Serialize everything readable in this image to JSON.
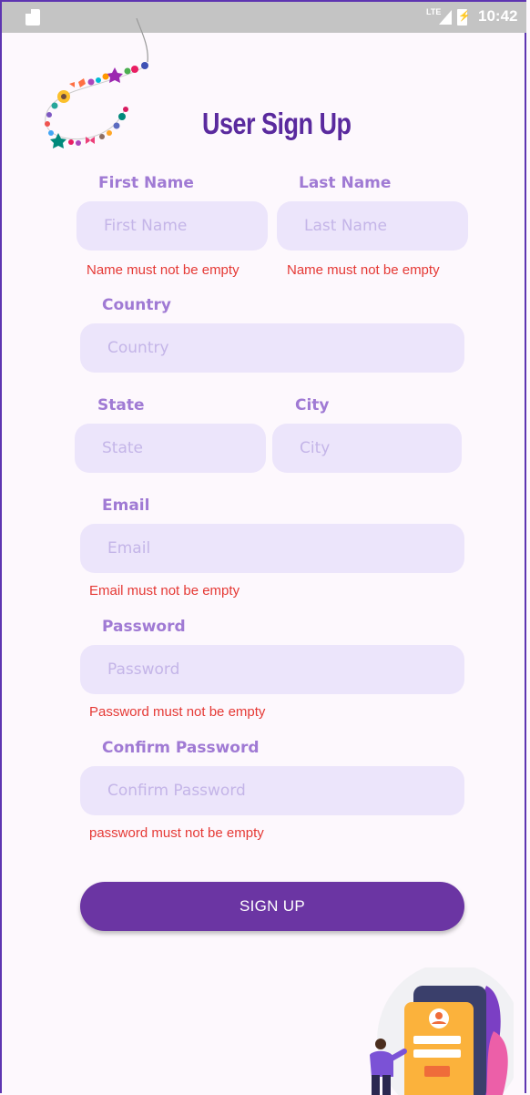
{
  "status_bar": {
    "network": "LTE",
    "time": "10:42"
  },
  "header": {
    "title": "User Sign Up"
  },
  "form": {
    "first_name": {
      "label": "First Name",
      "placeholder": "First Name",
      "error": "Name must not be empty"
    },
    "last_name": {
      "label": "Last Name",
      "placeholder": "Last Name",
      "error": "Name must not be empty"
    },
    "country": {
      "label": "Country",
      "placeholder": "Country"
    },
    "state": {
      "label": "State",
      "placeholder": "State"
    },
    "city": {
      "label": "City",
      "placeholder": "City"
    },
    "email": {
      "label": "Email",
      "placeholder": "Email",
      "error": "Email must not be empty"
    },
    "password": {
      "label": "Password",
      "placeholder": "Password",
      "error": "Password must not be empty"
    },
    "confirm_password": {
      "label": "Confirm Password",
      "placeholder": "Confirm Password",
      "error": "password must not be empty"
    },
    "submit_label": "SIGN UP"
  },
  "colors": {
    "primary": "#6b35a3",
    "title": "#5a2a9e",
    "label": "#a07ad4",
    "field_bg": "#ece5fb",
    "error": "#e53935",
    "background": "#fdf8fd"
  }
}
